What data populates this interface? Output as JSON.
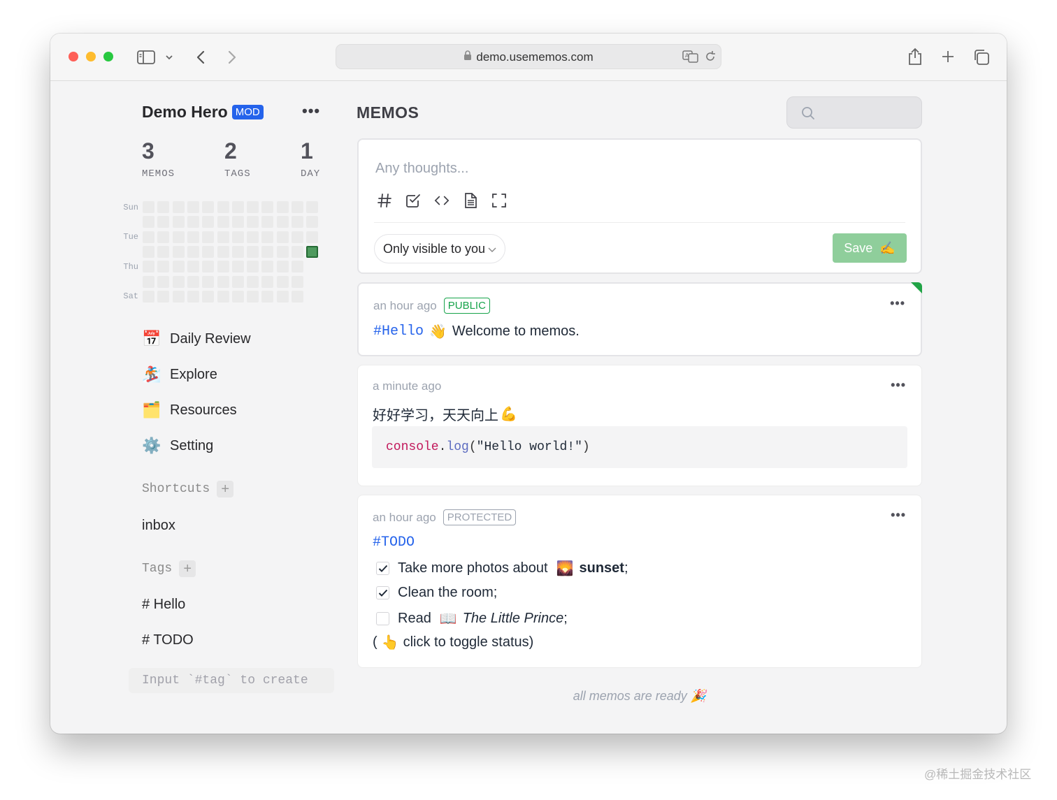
{
  "browser": {
    "url": "demo.usememos.com"
  },
  "sidebar": {
    "user_name": "Demo Hero",
    "role_badge": "MOD",
    "stats": [
      {
        "value": "3",
        "label": "MEMOS"
      },
      {
        "value": "2",
        "label": "TAGS"
      },
      {
        "value": "1",
        "label": "DAY"
      }
    ],
    "heatmap_days": [
      "Sun",
      "Tue",
      "Thu",
      "Sat"
    ],
    "nav": [
      {
        "emoji": "📅",
        "label": "Daily Review"
      },
      {
        "emoji": "🏂",
        "label": "Explore"
      },
      {
        "emoji": "🗂️",
        "label": "Resources"
      },
      {
        "emoji": "⚙️",
        "label": "Setting"
      }
    ],
    "shortcuts_title": "Shortcuts",
    "shortcuts": [
      "inbox"
    ],
    "tags_title": "Tags",
    "tags": [
      "# Hello",
      "# TODO"
    ],
    "tag_input_placeholder": "Input `#tag` to create"
  },
  "main": {
    "title": "MEMOS",
    "editor": {
      "placeholder": "Any thoughts...",
      "visibility": "Only visible to you",
      "save_label": "Save",
      "save_emoji": "✍️"
    },
    "memos": [
      {
        "time": "an hour ago",
        "visibility": "PUBLIC",
        "tag": "#Hello",
        "emoji": "👋",
        "text": "Welcome to memos."
      },
      {
        "time": "a minute ago",
        "text": "好好学习，天天向上",
        "emoji": "💪",
        "code": {
          "obj": "console",
          "dot": ".",
          "fn": "log",
          "open": "(",
          "str": "\"Hello world!\"",
          "close": ")"
        }
      },
      {
        "time": "an hour ago",
        "visibility": "PROTECTED",
        "tag": "#TODO",
        "todos": [
          {
            "checked": true,
            "text": "Take more photos about",
            "emoji": "🌄",
            "bold": "sunset",
            "tail": ";"
          },
          {
            "checked": true,
            "text": "Clean the room;"
          },
          {
            "checked": false,
            "text": "Read",
            "emoji": "📖",
            "italic": "The Little Prince",
            "tail": ";"
          }
        ],
        "note_open": "(",
        "note_emoji": "👆",
        "note_text": "click to toggle status)"
      }
    ],
    "footer_text": "all memos are ready",
    "footer_emoji": "🎉"
  },
  "watermark": "@稀土掘金技术社区"
}
